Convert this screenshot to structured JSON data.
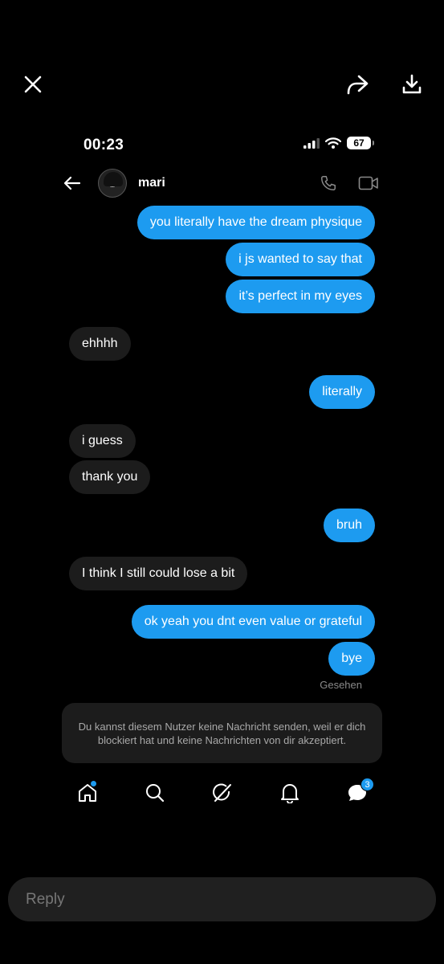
{
  "status_bar": {
    "time": "00:23",
    "battery": "67"
  },
  "header": {
    "contact_name": "mari"
  },
  "messages": [
    {
      "text": "you literally have the dream physique",
      "side": "sent"
    },
    {
      "text": "i js wanted to say that",
      "side": "sent"
    },
    {
      "text": "it’s perfect in my eyes",
      "side": "sent"
    },
    {
      "text": "ehhhh",
      "side": "received"
    },
    {
      "text": "literally",
      "side": "sent"
    },
    {
      "text": "i guess",
      "side": "received"
    },
    {
      "text": "thank you",
      "side": "received"
    },
    {
      "text": "bruh",
      "side": "sent"
    },
    {
      "text": "I think I still could lose a bit",
      "side": "received"
    },
    {
      "text": "ok yeah you dnt even value or grateful",
      "side": "sent"
    },
    {
      "text": "bye",
      "side": "sent"
    }
  ],
  "seen_label": "Gesehen",
  "blocked_notice": "Du kannst diesem Nutzer keine Nachricht senden, weil er dich blockiert hat und keine Nachrichten von dir akzeptiert.",
  "bottom_nav": {
    "messages_badge": "3"
  },
  "reply": {
    "placeholder": "Reply"
  },
  "colors": {
    "sent_bubble": "#1d9bf0",
    "received_bubble": "#1c1c1c",
    "background": "#000000"
  },
  "icons": [
    "close-icon",
    "share-icon",
    "download-icon",
    "back-arrow-icon",
    "phone-icon",
    "video-icon",
    "home-icon",
    "search-icon",
    "grok-icon",
    "bell-icon",
    "messages-icon"
  ]
}
